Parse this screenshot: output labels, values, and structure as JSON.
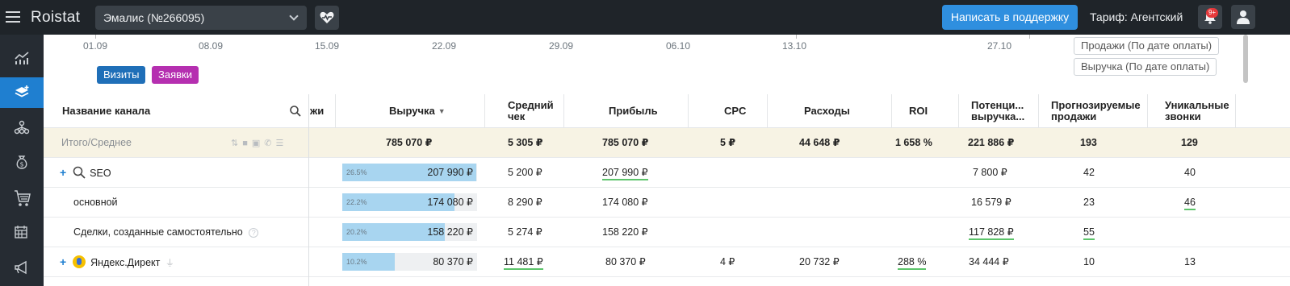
{
  "topbar": {
    "logo": "Roistat",
    "project": "Эмалис (№266095)",
    "support_button": "Написать в поддержку",
    "tariff": "Тариф: Агентский",
    "notifications_badge": "9+",
    "bg_color": "#1f2429",
    "accent_color": "#2f8fdf"
  },
  "sidebar": {
    "items": [
      {
        "icon": "analytics-chart-icon",
        "active": false
      },
      {
        "icon": "layers-icon",
        "active": true
      },
      {
        "icon": "hierarchy-icon",
        "active": false
      },
      {
        "icon": "money-bag-icon",
        "active": false
      },
      {
        "icon": "cart-icon",
        "active": false
      },
      {
        "icon": "calendar-icon",
        "active": false
      },
      {
        "icon": "megaphone-icon",
        "active": false
      }
    ]
  },
  "chart_axis": {
    "dates": [
      "01.09",
      "08.09",
      "15.09",
      "22.09",
      "29.09",
      "06.10",
      "13.10",
      "27.10"
    ],
    "legend": [
      {
        "label": "Визиты",
        "color": "#1f6fb8"
      },
      {
        "label": "Заявки",
        "color": "#b52fb0"
      }
    ],
    "right_buttons": [
      "Продажи (По дате оплаты)",
      "Выручка (По дате оплаты)"
    ]
  },
  "table": {
    "columns": {
      "name": "Название канала",
      "partial": "жи",
      "revenue": "Выручка",
      "avg_check": "Средний чек",
      "profit": "Прибыль",
      "cpc": "CPC",
      "costs": "Расходы",
      "roi": "ROI",
      "potential": "Потенци... выручка...",
      "forecast": "Прогнозируемые продажи",
      "unique_calls": "Уникальные звонки"
    },
    "total": {
      "name": "Итого/Среднее",
      "revenue": "785 070 ₽",
      "avg_check": "5 305 ₽",
      "profit": "785 070 ₽",
      "cpc": "5 ₽",
      "costs": "44 648 ₽",
      "roi": "1 658 %",
      "potential": "221 886 ₽",
      "forecast": "193",
      "unique_calls": "129"
    },
    "rows": [
      {
        "name": "SEO",
        "pct": "26.5%",
        "share": 0.995,
        "revenue": "207 990 ₽",
        "avg_check": "5 200 ₽",
        "profit": "207 990 ₽",
        "cpc": "",
        "costs": "",
        "roi": "",
        "potential": "7 800 ₽",
        "forecast": "42",
        "unique_calls": "40"
      },
      {
        "name": "основной",
        "pct": "22.2%",
        "share": 0.83,
        "revenue": "174 080 ₽",
        "avg_check": "8 290 ₽",
        "profit": "174 080 ₽",
        "cpc": "",
        "costs": "",
        "roi": "",
        "potential": "16 579 ₽",
        "forecast": "23",
        "unique_calls": "46"
      },
      {
        "name": "Сделки, созданные самостоятельно",
        "pct": "20.2%",
        "share": 0.76,
        "revenue": "158 220 ₽",
        "avg_check": "5 274 ₽",
        "profit": "158 220 ₽",
        "cpc": "",
        "costs": "",
        "roi": "",
        "potential": "117 828 ₽",
        "forecast": "55",
        "unique_calls": ""
      },
      {
        "name": "Яндекс.Директ",
        "pct": "10.2%",
        "share": 0.39,
        "revenue": "80 370 ₽",
        "avg_check": "11 481 ₽",
        "profit": "80 370 ₽",
        "cpc": "4 ₽",
        "costs": "20 732 ₽",
        "roi": "288 %",
        "potential": "34 444 ₽",
        "forecast": "10",
        "unique_calls": "13"
      }
    ]
  }
}
